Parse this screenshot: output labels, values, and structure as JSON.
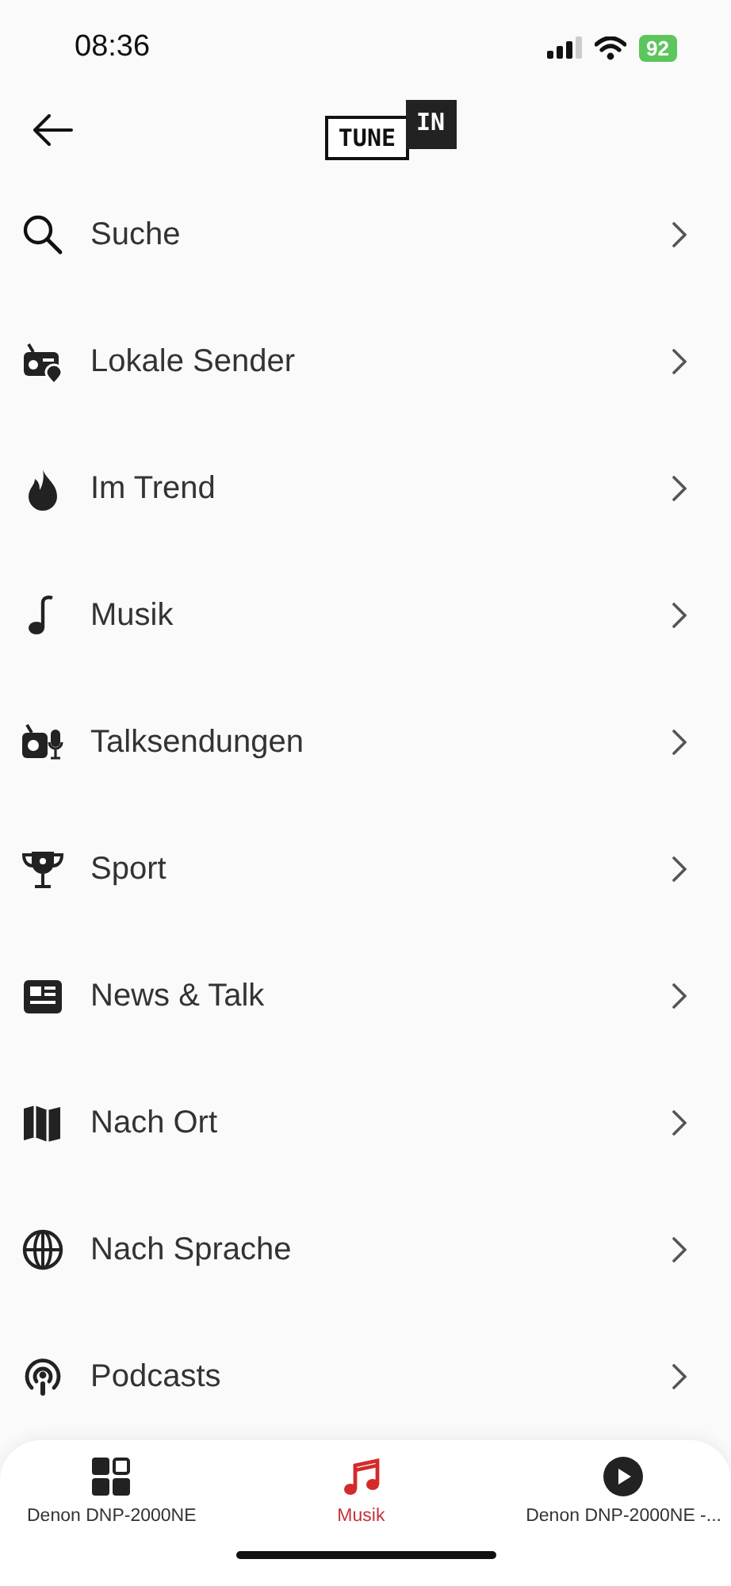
{
  "status_bar": {
    "time": "08:36",
    "battery": "92"
  },
  "header": {
    "logo": [
      "TUNE",
      "IN"
    ]
  },
  "menu": [
    {
      "label": "Suche",
      "kind": "search"
    },
    {
      "label": "Lokale Sender",
      "kind": "local"
    },
    {
      "label": "Im Trend",
      "kind": "trend"
    },
    {
      "label": "Musik",
      "kind": "music"
    },
    {
      "label": "Talksendungen",
      "kind": "talk"
    },
    {
      "label": "Sport",
      "kind": "sport"
    },
    {
      "label": "News & Talk",
      "kind": "news"
    },
    {
      "label": "Nach Ort",
      "kind": "map"
    },
    {
      "label": "Nach Sprache",
      "kind": "globe"
    },
    {
      "label": "Podcasts",
      "kind": "podcast"
    }
  ],
  "tab_bar": [
    {
      "label": "Denon DNP-2000NE",
      "kind": "grid",
      "selected": false
    },
    {
      "label": "Musik",
      "kind": "music",
      "selected": true
    },
    {
      "label": "Denon DNP-2000NE -...",
      "kind": "play",
      "selected": false
    }
  ]
}
